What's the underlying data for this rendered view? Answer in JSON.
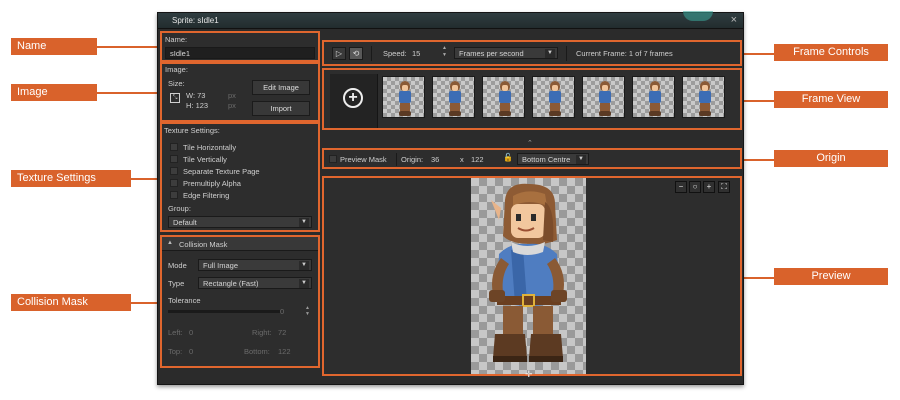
{
  "window": {
    "title": "Sprite: sIdle1",
    "close": "×"
  },
  "name_panel": {
    "label": "Name:",
    "value": "sIdle1"
  },
  "image_panel": {
    "label": "Image:",
    "size_label": "Size:",
    "width": "W: 73",
    "height": "H: 123",
    "unit": "px",
    "edit_button": "Edit Image",
    "import_button": "Import"
  },
  "texture_panel": {
    "label": "Texture Settings:",
    "options": [
      "Tile Horizontally",
      "Tile Vertically",
      "Separate Texture Page",
      "Premultiply Alpha",
      "Edge Filtering"
    ],
    "group_label": "Group:",
    "group_value": "Default"
  },
  "collision_panel": {
    "header": "Collision Mask",
    "mode_label": "Mode",
    "mode_value": "Full Image",
    "type_label": "Type",
    "type_value": "Rectangle (Fast)",
    "tolerance_label": "Tolerance",
    "tolerance_value": "0",
    "left_label": "Left:",
    "left_value": "0",
    "right_label": "Right:",
    "right_value": "72",
    "top_label": "Top:",
    "top_value": "0",
    "bottom_label": "Bottom:",
    "bottom_value": "122"
  },
  "frame_controls": {
    "speed_label": "Speed:",
    "speed_value": "15",
    "speed_unit": "Frames per second",
    "current_frame": "Current Frame: 1 of 7 frames"
  },
  "frame_view": {
    "frame_count": 7,
    "selected_index": 0
  },
  "origin_bar": {
    "preview_mask_label": "Preview Mask",
    "origin_label": "Origin:",
    "origin_x": "36",
    "x_separator": "x",
    "origin_y": "122",
    "origin_preset": "Bottom Centre"
  },
  "callouts": {
    "name": "Name",
    "image": "Image",
    "texture": "Texture Settings",
    "collision": "Collision Mask",
    "frame_controls": "Frame Controls",
    "frame_view": "Frame View",
    "origin": "Origin",
    "preview": "Preview"
  },
  "colors": {
    "callout": "#d9622b",
    "panel_border": "#e0662e",
    "window_bg": "#2b2b2b",
    "selected_frame_marker": "#36b39a"
  }
}
